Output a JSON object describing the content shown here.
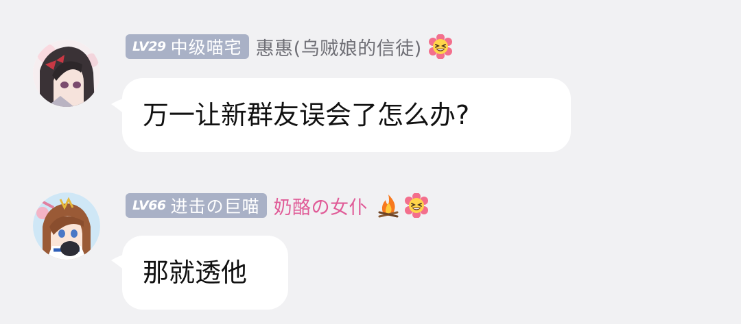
{
  "messages": [
    {
      "level": "LV29",
      "title": "中级喵宅",
      "nickname": "惠惠(乌贼娘的信徒)",
      "nickname_color": "#6f6f76",
      "badges": [
        "grin-flower-icon"
      ],
      "text": "万一让新群友误会了怎么办?"
    },
    {
      "level": "LV66",
      "title": "进击の巨喵",
      "nickname": "奶酪の女仆",
      "nickname_color": "#e05b97",
      "badges": [
        "fire-icon",
        "grin-flower-icon"
      ],
      "text": "那就透他"
    }
  ],
  "colors": {
    "background": "#f1f1f3",
    "bubble": "#ffffff",
    "level_badge": "#a9b1c6"
  }
}
